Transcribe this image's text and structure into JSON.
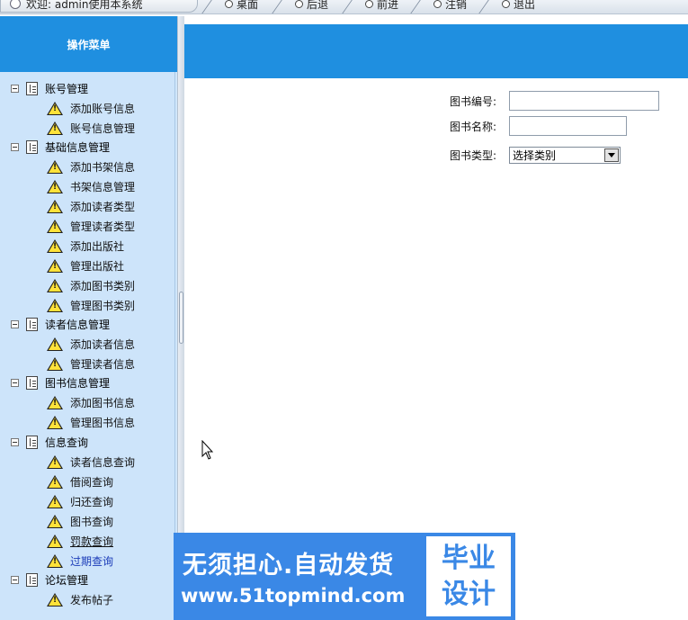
{
  "topbar": {
    "welcome": "欢迎: admin使用本系统",
    "nav": [
      "桌面",
      "后退",
      "前进",
      "注销",
      "退出"
    ]
  },
  "sidebar": {
    "title": "操作菜单",
    "groups": [
      {
        "label": "账号管理",
        "items": [
          "添加账号信息",
          "账号信息管理"
        ]
      },
      {
        "label": "基础信息管理",
        "items": [
          "添加书架信息",
          "书架信息管理",
          "添加读者类型",
          "管理读者类型",
          "添加出版社",
          "管理出版社",
          "添加图书类别",
          "管理图书类别"
        ]
      },
      {
        "label": "读者信息管理",
        "items": [
          "添加读者信息",
          "管理读者信息"
        ]
      },
      {
        "label": "图书信息管理",
        "items": [
          "添加图书信息",
          "管理图书信息"
        ]
      },
      {
        "label": "信息查询",
        "items": [
          "读者信息查询",
          "借阅查询",
          "归还查询",
          "图书查询",
          "罚款查询",
          "过期查询"
        ]
      },
      {
        "label": "论坛管理",
        "items": [
          "发布帖子"
        ]
      }
    ]
  },
  "form": {
    "book_id_label": "图书编号:",
    "book_id_value": "",
    "book_name_label": "图书名称:",
    "book_name_value": "",
    "book_type_label": "图书类型:",
    "book_type_selected": "选择类别"
  },
  "watermark": {
    "line1": "无须担心.自动发货",
    "line2": "www.51topmind.com",
    "box_top": "毕业",
    "box_bottom": "设计"
  },
  "colors": {
    "header_blue": "#1f8fe0",
    "sidebar_bg": "#cde4fa",
    "watermark_blue": "#3a88e6"
  }
}
